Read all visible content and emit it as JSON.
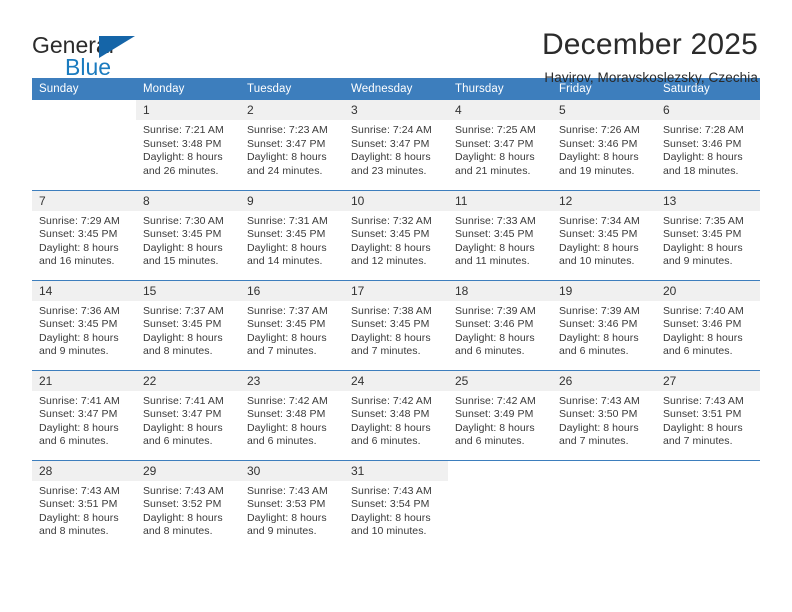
{
  "brand": {
    "name_part1": "General",
    "name_part2": "Blue",
    "logo_icon": "triangle-logo-icon"
  },
  "header": {
    "month_title": "December 2025",
    "location": "Havirov, Moravskoslezsky, Czechia"
  },
  "colors": {
    "header_blue": "#3d7ebd",
    "brand_blue": "#1a7bbf",
    "daynum_bg": "#f0f0f0",
    "text": "#3a3a3a"
  },
  "calendar": {
    "weekday_headers": [
      "Sunday",
      "Monday",
      "Tuesday",
      "Wednesday",
      "Thursday",
      "Friday",
      "Saturday"
    ],
    "weeks": [
      [
        {
          "day": "",
          "empty": true,
          "sunrise": "",
          "sunset": "",
          "daylight_line1": "",
          "daylight_line2": ""
        },
        {
          "day": "1",
          "empty": false,
          "sunrise": "Sunrise: 7:21 AM",
          "sunset": "Sunset: 3:48 PM",
          "daylight_line1": "Daylight: 8 hours",
          "daylight_line2": "and 26 minutes."
        },
        {
          "day": "2",
          "empty": false,
          "sunrise": "Sunrise: 7:23 AM",
          "sunset": "Sunset: 3:47 PM",
          "daylight_line1": "Daylight: 8 hours",
          "daylight_line2": "and 24 minutes."
        },
        {
          "day": "3",
          "empty": false,
          "sunrise": "Sunrise: 7:24 AM",
          "sunset": "Sunset: 3:47 PM",
          "daylight_line1": "Daylight: 8 hours",
          "daylight_line2": "and 23 minutes."
        },
        {
          "day": "4",
          "empty": false,
          "sunrise": "Sunrise: 7:25 AM",
          "sunset": "Sunset: 3:47 PM",
          "daylight_line1": "Daylight: 8 hours",
          "daylight_line2": "and 21 minutes."
        },
        {
          "day": "5",
          "empty": false,
          "sunrise": "Sunrise: 7:26 AM",
          "sunset": "Sunset: 3:46 PM",
          "daylight_line1": "Daylight: 8 hours",
          "daylight_line2": "and 19 minutes."
        },
        {
          "day": "6",
          "empty": false,
          "sunrise": "Sunrise: 7:28 AM",
          "sunset": "Sunset: 3:46 PM",
          "daylight_line1": "Daylight: 8 hours",
          "daylight_line2": "and 18 minutes."
        }
      ],
      [
        {
          "day": "7",
          "empty": false,
          "sunrise": "Sunrise: 7:29 AM",
          "sunset": "Sunset: 3:45 PM",
          "daylight_line1": "Daylight: 8 hours",
          "daylight_line2": "and 16 minutes."
        },
        {
          "day": "8",
          "empty": false,
          "sunrise": "Sunrise: 7:30 AM",
          "sunset": "Sunset: 3:45 PM",
          "daylight_line1": "Daylight: 8 hours",
          "daylight_line2": "and 15 minutes."
        },
        {
          "day": "9",
          "empty": false,
          "sunrise": "Sunrise: 7:31 AM",
          "sunset": "Sunset: 3:45 PM",
          "daylight_line1": "Daylight: 8 hours",
          "daylight_line2": "and 14 minutes."
        },
        {
          "day": "10",
          "empty": false,
          "sunrise": "Sunrise: 7:32 AM",
          "sunset": "Sunset: 3:45 PM",
          "daylight_line1": "Daylight: 8 hours",
          "daylight_line2": "and 12 minutes."
        },
        {
          "day": "11",
          "empty": false,
          "sunrise": "Sunrise: 7:33 AM",
          "sunset": "Sunset: 3:45 PM",
          "daylight_line1": "Daylight: 8 hours",
          "daylight_line2": "and 11 minutes."
        },
        {
          "day": "12",
          "empty": false,
          "sunrise": "Sunrise: 7:34 AM",
          "sunset": "Sunset: 3:45 PM",
          "daylight_line1": "Daylight: 8 hours",
          "daylight_line2": "and 10 minutes."
        },
        {
          "day": "13",
          "empty": false,
          "sunrise": "Sunrise: 7:35 AM",
          "sunset": "Sunset: 3:45 PM",
          "daylight_line1": "Daylight: 8 hours",
          "daylight_line2": "and 9 minutes."
        }
      ],
      [
        {
          "day": "14",
          "empty": false,
          "sunrise": "Sunrise: 7:36 AM",
          "sunset": "Sunset: 3:45 PM",
          "daylight_line1": "Daylight: 8 hours",
          "daylight_line2": "and 9 minutes."
        },
        {
          "day": "15",
          "empty": false,
          "sunrise": "Sunrise: 7:37 AM",
          "sunset": "Sunset: 3:45 PM",
          "daylight_line1": "Daylight: 8 hours",
          "daylight_line2": "and 8 minutes."
        },
        {
          "day": "16",
          "empty": false,
          "sunrise": "Sunrise: 7:37 AM",
          "sunset": "Sunset: 3:45 PM",
          "daylight_line1": "Daylight: 8 hours",
          "daylight_line2": "and 7 minutes."
        },
        {
          "day": "17",
          "empty": false,
          "sunrise": "Sunrise: 7:38 AM",
          "sunset": "Sunset: 3:45 PM",
          "daylight_line1": "Daylight: 8 hours",
          "daylight_line2": "and 7 minutes."
        },
        {
          "day": "18",
          "empty": false,
          "sunrise": "Sunrise: 7:39 AM",
          "sunset": "Sunset: 3:46 PM",
          "daylight_line1": "Daylight: 8 hours",
          "daylight_line2": "and 6 minutes."
        },
        {
          "day": "19",
          "empty": false,
          "sunrise": "Sunrise: 7:39 AM",
          "sunset": "Sunset: 3:46 PM",
          "daylight_line1": "Daylight: 8 hours",
          "daylight_line2": "and 6 minutes."
        },
        {
          "day": "20",
          "empty": false,
          "sunrise": "Sunrise: 7:40 AM",
          "sunset": "Sunset: 3:46 PM",
          "daylight_line1": "Daylight: 8 hours",
          "daylight_line2": "and 6 minutes."
        }
      ],
      [
        {
          "day": "21",
          "empty": false,
          "sunrise": "Sunrise: 7:41 AM",
          "sunset": "Sunset: 3:47 PM",
          "daylight_line1": "Daylight: 8 hours",
          "daylight_line2": "and 6 minutes."
        },
        {
          "day": "22",
          "empty": false,
          "sunrise": "Sunrise: 7:41 AM",
          "sunset": "Sunset: 3:47 PM",
          "daylight_line1": "Daylight: 8 hours",
          "daylight_line2": "and 6 minutes."
        },
        {
          "day": "23",
          "empty": false,
          "sunrise": "Sunrise: 7:42 AM",
          "sunset": "Sunset: 3:48 PM",
          "daylight_line1": "Daylight: 8 hours",
          "daylight_line2": "and 6 minutes."
        },
        {
          "day": "24",
          "empty": false,
          "sunrise": "Sunrise: 7:42 AM",
          "sunset": "Sunset: 3:48 PM",
          "daylight_line1": "Daylight: 8 hours",
          "daylight_line2": "and 6 minutes."
        },
        {
          "day": "25",
          "empty": false,
          "sunrise": "Sunrise: 7:42 AM",
          "sunset": "Sunset: 3:49 PM",
          "daylight_line1": "Daylight: 8 hours",
          "daylight_line2": "and 6 minutes."
        },
        {
          "day": "26",
          "empty": false,
          "sunrise": "Sunrise: 7:43 AM",
          "sunset": "Sunset: 3:50 PM",
          "daylight_line1": "Daylight: 8 hours",
          "daylight_line2": "and 7 minutes."
        },
        {
          "day": "27",
          "empty": false,
          "sunrise": "Sunrise: 7:43 AM",
          "sunset": "Sunset: 3:51 PM",
          "daylight_line1": "Daylight: 8 hours",
          "daylight_line2": "and 7 minutes."
        }
      ],
      [
        {
          "day": "28",
          "empty": false,
          "sunrise": "Sunrise: 7:43 AM",
          "sunset": "Sunset: 3:51 PM",
          "daylight_line1": "Daylight: 8 hours",
          "daylight_line2": "and 8 minutes."
        },
        {
          "day": "29",
          "empty": false,
          "sunrise": "Sunrise: 7:43 AM",
          "sunset": "Sunset: 3:52 PM",
          "daylight_line1": "Daylight: 8 hours",
          "daylight_line2": "and 8 minutes."
        },
        {
          "day": "30",
          "empty": false,
          "sunrise": "Sunrise: 7:43 AM",
          "sunset": "Sunset: 3:53 PM",
          "daylight_line1": "Daylight: 8 hours",
          "daylight_line2": "and 9 minutes."
        },
        {
          "day": "31",
          "empty": false,
          "sunrise": "Sunrise: 7:43 AM",
          "sunset": "Sunset: 3:54 PM",
          "daylight_line1": "Daylight: 8 hours",
          "daylight_line2": "and 10 minutes."
        },
        {
          "day": "",
          "empty": true,
          "sunrise": "",
          "sunset": "",
          "daylight_line1": "",
          "daylight_line2": ""
        },
        {
          "day": "",
          "empty": true,
          "sunrise": "",
          "sunset": "",
          "daylight_line1": "",
          "daylight_line2": ""
        },
        {
          "day": "",
          "empty": true,
          "sunrise": "",
          "sunset": "",
          "daylight_line1": "",
          "daylight_line2": ""
        }
      ]
    ]
  }
}
